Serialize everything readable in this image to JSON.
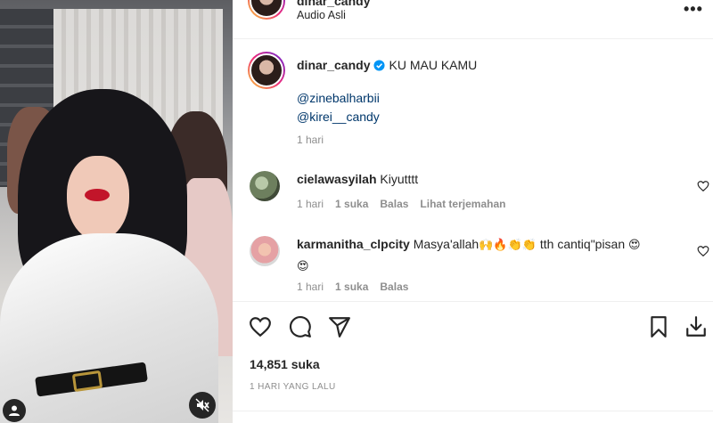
{
  "header": {
    "username": "dinar_candy",
    "audio": "Audio Asli",
    "more_label": "•••"
  },
  "caption": {
    "username": "dinar_candy",
    "text": "KU MAU KAMU",
    "mentions": [
      "@zinebalharbii",
      "@kirei__candy"
    ],
    "time": "1 hari"
  },
  "comments": [
    {
      "username": "cielawasyilah",
      "text": "Kiyutttt",
      "time": "1 hari",
      "likes": "1 suka",
      "reply": "Balas",
      "translate": "Lihat terjemahan"
    },
    {
      "username": "karmanitha_clpcity",
      "text": "Masya'allah",
      "emojis": "🙌🔥👏👏",
      "text2": "tth cantiq\"pisan",
      "emoji_end": "😍",
      "emoji_line2": "😍",
      "time": "1 hari",
      "likes": "1 suka",
      "reply": "Balas"
    }
  ],
  "stats": {
    "likes": "14,851 suka",
    "date": "1 HARI YANG LALU"
  },
  "icons": {
    "like": "heart-icon",
    "comment": "comment-icon",
    "share": "send-icon",
    "save": "bookmark-icon",
    "download": "download-icon",
    "mute": "muted-speaker-icon",
    "tagged": "user-icon",
    "verified": "verified-badge-icon"
  },
  "colors": {
    "link": "#00376b",
    "secondary_text": "#8e8e8e",
    "verified": "#0095f6"
  }
}
